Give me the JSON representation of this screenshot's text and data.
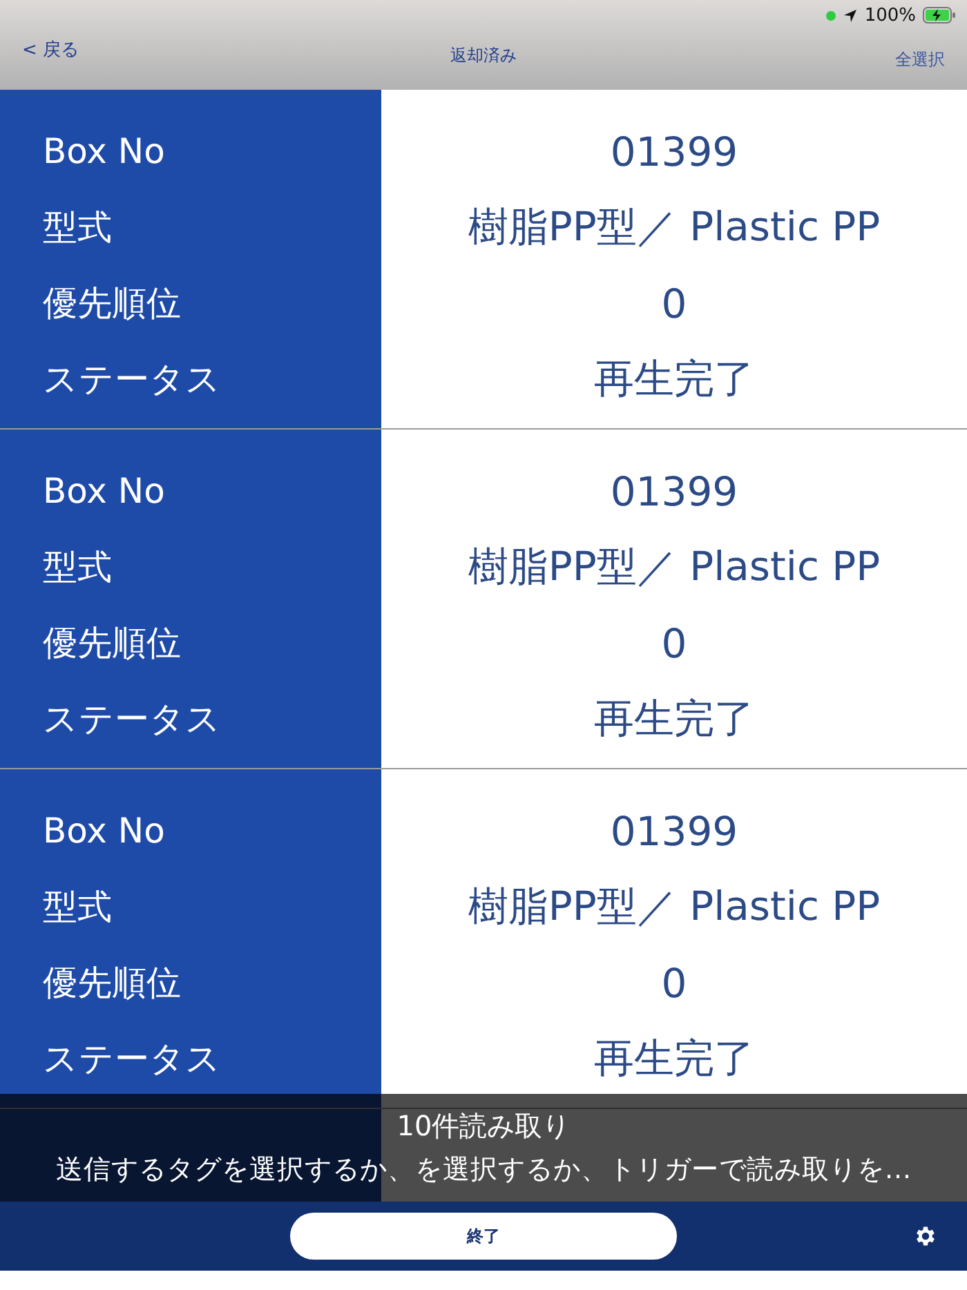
{
  "status_bar": {
    "battery": "100%"
  },
  "nav": {
    "back": "< 戻る",
    "title": "返却済み",
    "action": "全選択"
  },
  "records": [
    {
      "fields": [
        {
          "label": "Box No",
          "value": "01399"
        },
        {
          "label": "型式",
          "value": "樹脂PP型／ Plastic PP"
        },
        {
          "label": "優先順位",
          "value": "0"
        },
        {
          "label": "ステータス",
          "value": "再生完了"
        }
      ]
    },
    {
      "fields": [
        {
          "label": "Box No",
          "value": "01399"
        },
        {
          "label": "型式",
          "value": "樹脂PP型／ Plastic PP"
        },
        {
          "label": "優先順位",
          "value": "0"
        },
        {
          "label": "ステータス",
          "value": "再生完了"
        }
      ]
    },
    {
      "fields": [
        {
          "label": "Box No",
          "value": "01399"
        },
        {
          "label": "型式",
          "value": "樹脂PP型／ Plastic PP"
        },
        {
          "label": "優先順位",
          "value": "0"
        },
        {
          "label": "ステータス",
          "value": "再生完了"
        }
      ]
    }
  ],
  "overlay": {
    "count": "10件読み取り",
    "message": "送信するタグを選択するか、を選択するか、トリガーで読み取りを…"
  },
  "footer": {
    "button": "終了"
  }
}
